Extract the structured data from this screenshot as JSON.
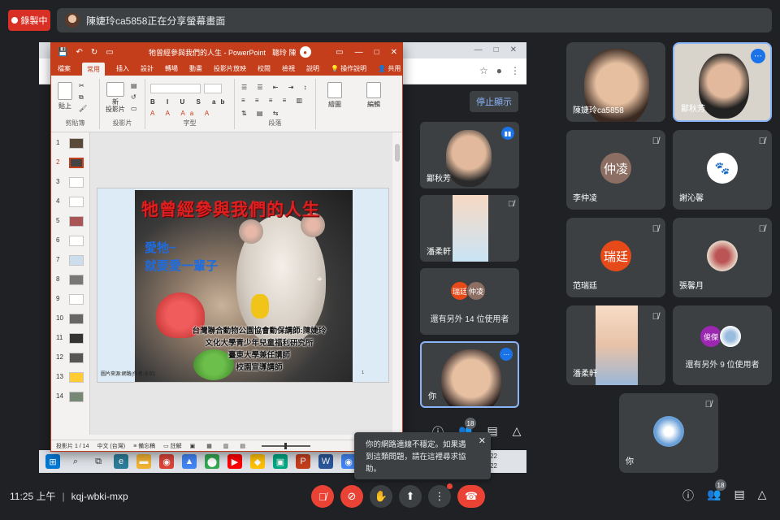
{
  "recording": {
    "label": "錄製中"
  },
  "banner": {
    "text": "陳婕玲ca5858正在分享螢幕畫面"
  },
  "shared": {
    "stop_label": "停止顯示",
    "mini_tiles": [
      {
        "name": "鄙秋芳",
        "speaking": true
      },
      {
        "name": "潘柔軒",
        "muted": true
      },
      {
        "initials": [
          "瑞廷",
          "仲凌"
        ],
        "others_text": "還有另外 14 位使用者"
      },
      {
        "name": "你",
        "more": true
      }
    ],
    "mini_count": "18"
  },
  "ppt": {
    "title": "牠曾經參與我們的人生 - PowerPoint",
    "user": "聰玲 陳",
    "tabs": [
      "檔案",
      "常用",
      "插入",
      "設計",
      "轉場",
      "動畫",
      "投影片放映",
      "校閱",
      "檢視",
      "說明",
      "操作說明",
      "共用"
    ],
    "active_tab": "常用",
    "ribbon": {
      "clipboard": {
        "paste": "貼上",
        "label": "剪貼簿"
      },
      "slides": {
        "new_slide": "新\n投影片",
        "label": "投影片"
      },
      "font": {
        "label": "字型"
      },
      "paragraph": {
        "label": "段落"
      },
      "drawing": {
        "btn": "繪圖"
      },
      "editing": {
        "btn": "編輯"
      }
    },
    "thumbnails": [
      "1",
      "2",
      "3",
      "4",
      "5",
      "6",
      "7",
      "8",
      "9",
      "10",
      "11",
      "12",
      "13",
      "14"
    ],
    "active_thumb": 2,
    "slide": {
      "title": "牠曾經參與我們的人生",
      "sub1": "愛牠~",
      "sub2": "就要愛一輩子",
      "credits": [
        "台灣聯合動物公園協會動保講師:陳婕玲",
        "文化大學青少年兒童福利研究所",
        "臺東大學兼任講師",
        "校園宣導講師"
      ],
      "source": "圖片來源:網路(作者:未知)",
      "page": "1"
    },
    "status": {
      "slide": "投影片 1 / 14",
      "lang": "中文 (台灣)",
      "notes": "備忘稿",
      "comments": "註解"
    }
  },
  "taskbar": {
    "time": "22",
    "date": "22"
  },
  "participants": [
    {
      "name": "陳婕玲ca5858",
      "type": "video"
    },
    {
      "name": "鄙秋芳",
      "type": "video",
      "more": true
    },
    {
      "name": "李仲凌",
      "initial": "仲凌",
      "color": "#8d6e63",
      "muted": true
    },
    {
      "name": "謝沁馨",
      "type": "avatar",
      "muted": true
    },
    {
      "name": "范瑞廷",
      "initial": "瑞廷",
      "color": "#e64a19",
      "muted": true
    },
    {
      "name": "張馨月",
      "type": "avatar",
      "muted": true
    },
    {
      "name": "潘柔軒",
      "type": "video",
      "muted": true
    },
    {
      "others_initials": [
        "俊傑"
      ],
      "others_text": "還有另外 9 位使用者"
    },
    {
      "name": "你",
      "type": "avatar",
      "muted": true
    }
  ],
  "network_tip": {
    "text": "你的網路連線不穩定。如果遇到這類問題，請在這裡尋求協助。"
  },
  "bottom": {
    "time": "11:25 上午",
    "meeting_code": "kqj-wbki-mxp",
    "people_count": "18"
  },
  "colors": {
    "ppt_red": "#c43e1c",
    "meet_bg": "#202124",
    "tile": "#3c4043",
    "danger": "#ea4335",
    "accent": "#1a73e8"
  }
}
